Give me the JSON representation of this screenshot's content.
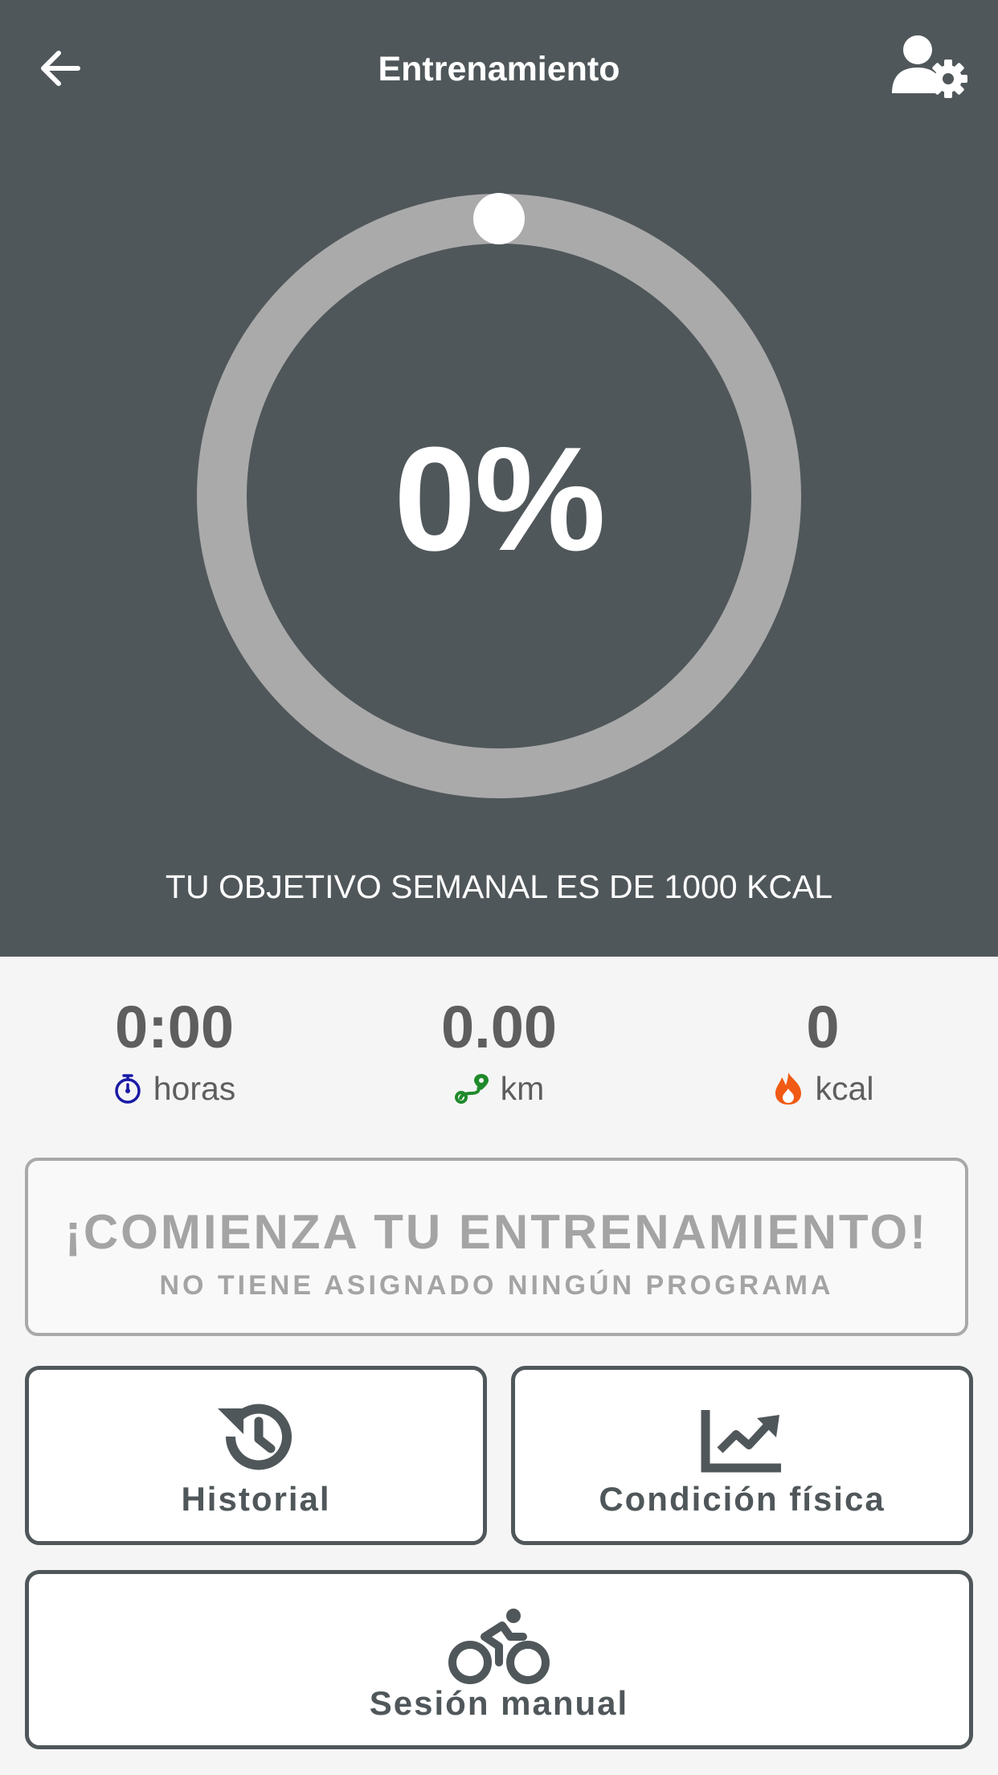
{
  "header": {
    "title": "Entrenamiento",
    "back_icon": "arrow-left-icon",
    "profile_icon": "user-settings-icon"
  },
  "progress": {
    "percent_label": "0%",
    "value_fraction": 0,
    "goal_text": "TU OBJETIVO SEMANAL ES DE 1000 KCAL"
  },
  "stats": {
    "time": {
      "value": "0:00",
      "unit": "horas",
      "icon": "stopwatch-icon",
      "color": "#1a1aa6"
    },
    "distance": {
      "value": "0.00",
      "unit": "km",
      "icon": "route-icon",
      "color": "#1f8a2a"
    },
    "calories": {
      "value": "0",
      "unit": "kcal",
      "icon": "flame-icon",
      "color": "#f05a14"
    }
  },
  "start_card": {
    "title": "¡COMIENZA TU ENTRENAMIENTO!",
    "subtitle": "NO TIENE ASIGNADO NINGÚN PROGRAMA"
  },
  "tiles": {
    "history": {
      "label": "Historial",
      "icon": "history-icon"
    },
    "fitness": {
      "label": "Condición física",
      "icon": "chart-line-icon"
    },
    "manual": {
      "label": "Sesión manual",
      "icon": "cyclist-icon"
    }
  },
  "colors": {
    "header_bg": "#50575a",
    "ring_track": "#aaaaaa",
    "ring_knob": "#ffffff",
    "page_bg": "#f5f5f5"
  }
}
